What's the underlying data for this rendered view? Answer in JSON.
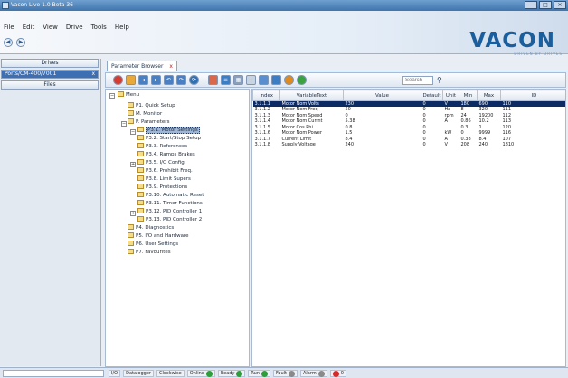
{
  "window": {
    "title": "Vacon Live 1.0 Beta 36"
  },
  "menu": [
    "File",
    "Edit",
    "View",
    "Drive",
    "Tools",
    "Help"
  ],
  "logo": {
    "text": "VACON",
    "subtitle": "DRIVEN BY DRIVES"
  },
  "left_panel": {
    "drives_label": "Drives",
    "connection_label": "Ports/CM-400/7001",
    "connection_close": "x",
    "files_label": "Files"
  },
  "tab": {
    "label": "Parameter Browser",
    "close": "x"
  },
  "toolbar": {
    "search_placeholder": "Search",
    "colors": {
      "stop": "#d83a2e",
      "ok": "#3aa340",
      "accent": "#1b5e9e",
      "warn": "#e08a1e"
    }
  },
  "tree": {
    "root": "Menu",
    "items": [
      "P1. Quick Setup",
      "M. Monitor",
      "P. Parameters",
      "P3.1. Motor Settings",
      "P3.2. Start/Stop Setup",
      "P3.3. References",
      "P3.4. Ramps Brakes",
      "P3.5. I/O Config",
      "P3.6. Prohibit Freq.",
      "P3.8. Limit Supers",
      "P3.9. Protections",
      "P3.10. Automatic Reset",
      "P3.11. Timer Functions",
      "P3.12. PID Controller 1",
      "P3.13. PID Controller 2",
      "P4. Diagnostics",
      "P5. I/O and Hardware",
      "P6. User Settings",
      "P7. Favourites"
    ]
  },
  "grid": {
    "columns": [
      "Index",
      "VariableText",
      "Value",
      "Default",
      "Unit",
      "Min",
      "Max",
      "ID"
    ],
    "rows": [
      [
        "3.1.1.1",
        "Motor Nom Volts",
        "230",
        "0",
        "V",
        "180",
        "690",
        "110"
      ],
      [
        "3.1.1.2",
        "Motor Nom Freq",
        "50",
        "0",
        "Hz",
        "8",
        "320",
        "111"
      ],
      [
        "3.1.1.3",
        "Motor Nom Speed",
        "0",
        "0",
        "rpm",
        "24",
        "19200",
        "112"
      ],
      [
        "3.1.1.4",
        "Motor Nom Currnt",
        "5.38",
        "0",
        "A",
        "0.86",
        "10.2",
        "113"
      ],
      [
        "3.1.1.5",
        "Motor Cos Phi",
        "0.8",
        "0",
        "",
        "0.3",
        "1",
        "120"
      ],
      [
        "3.1.1.6",
        "Motor Nom Power",
        "1.5",
        "0",
        "kW",
        "0",
        "9999",
        "116"
      ],
      [
        "3.1.1.7",
        "Current Limit",
        "8.4",
        "0",
        "A",
        "0.38",
        "8.4",
        "107"
      ],
      [
        "3.1.1.8",
        "Supply Voltage",
        "240",
        "0",
        "V",
        "208",
        "240",
        "1810"
      ]
    ]
  },
  "status": {
    "items": [
      {
        "label": "I/O",
        "led": ""
      },
      {
        "label": "Datalogger",
        "led": ""
      },
      {
        "label": "Clockwise",
        "led": ""
      },
      {
        "label": "Online",
        "led": "#2e9e3a"
      },
      {
        "label": "Ready",
        "led": "#2e9e3a"
      },
      {
        "label": "Run",
        "led": "#2e9e3a"
      },
      {
        "label": "Fault",
        "led": "#8a8a8a"
      },
      {
        "label": "Alarm",
        "led": "#8a8a8a"
      },
      {
        "label": "0",
        "led": "#d62a2a"
      }
    ]
  }
}
